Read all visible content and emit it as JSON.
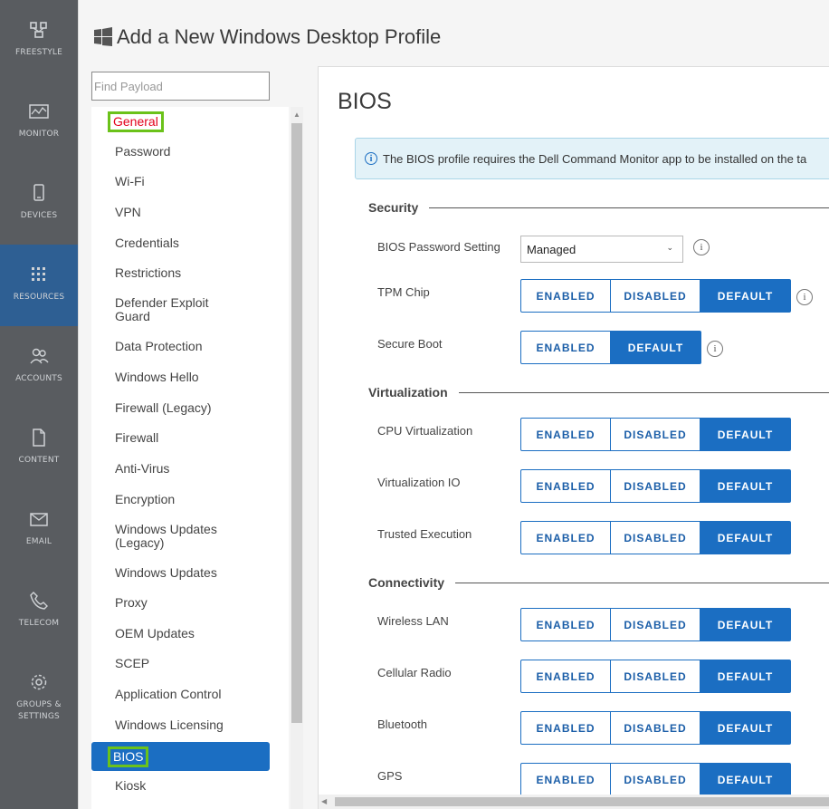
{
  "rail": [
    {
      "label": "FREESTYLE",
      "icon": "freestyle-icon"
    },
    {
      "label": "MONITOR",
      "icon": "monitor-icon"
    },
    {
      "label": "DEVICES",
      "icon": "devices-icon"
    },
    {
      "label": "RESOURCES",
      "icon": "resources-icon",
      "active": true
    },
    {
      "label": "ACCOUNTS",
      "icon": "accounts-icon"
    },
    {
      "label": "CONTENT",
      "icon": "content-icon"
    },
    {
      "label": "EMAIL",
      "icon": "email-icon"
    },
    {
      "label": "TELECOM",
      "icon": "telecom-icon"
    },
    {
      "label": "GROUPS &\nSETTINGS",
      "icon": "gear-icon"
    }
  ],
  "modal": {
    "title": "Add a New Windows Desktop Profile",
    "search_placeholder": "Find Payload"
  },
  "payloads": [
    "General",
    "Password",
    "Wi-Fi",
    "VPN",
    "Credentials",
    "Restrictions",
    "Defender Exploit Guard",
    "Data Protection",
    "Windows Hello",
    "Firewall (Legacy)",
    "Firewall",
    "Anti-Virus",
    "Encryption",
    "Windows Updates (Legacy)",
    "Windows Updates",
    "Proxy",
    "OEM Updates",
    "SCEP",
    "Application Control",
    "Windows Licensing",
    "BIOS",
    "Kiosk"
  ],
  "content": {
    "title": "BIOS",
    "info": "The BIOS profile requires the Dell Command Monitor app to be installed on the ta",
    "sections": {
      "security": "Security",
      "virtualization": "Virtualization",
      "connectivity": "Connectivity"
    },
    "password_setting": {
      "label": "BIOS Password Setting",
      "value": "Managed"
    },
    "options": {
      "enabled": "ENABLED",
      "disabled": "DISABLED",
      "default": "DEFAULT"
    },
    "rows": {
      "tpm": "TPM Chip",
      "secure_boot": "Secure Boot",
      "cpu_virt": "CPU Virtualization",
      "virt_io": "Virtualization IO",
      "trusted_exec": "Trusted Execution",
      "wlan": "Wireless LAN",
      "cellular": "Cellular Radio",
      "bluetooth": "Bluetooth",
      "gps": "GPS"
    },
    "help_glyph": "i",
    "selected_value": "DEFAULT"
  },
  "colors": {
    "accent": "#1b6ec2",
    "highlight": "#6bc21a",
    "general_text": "#e3001b"
  }
}
